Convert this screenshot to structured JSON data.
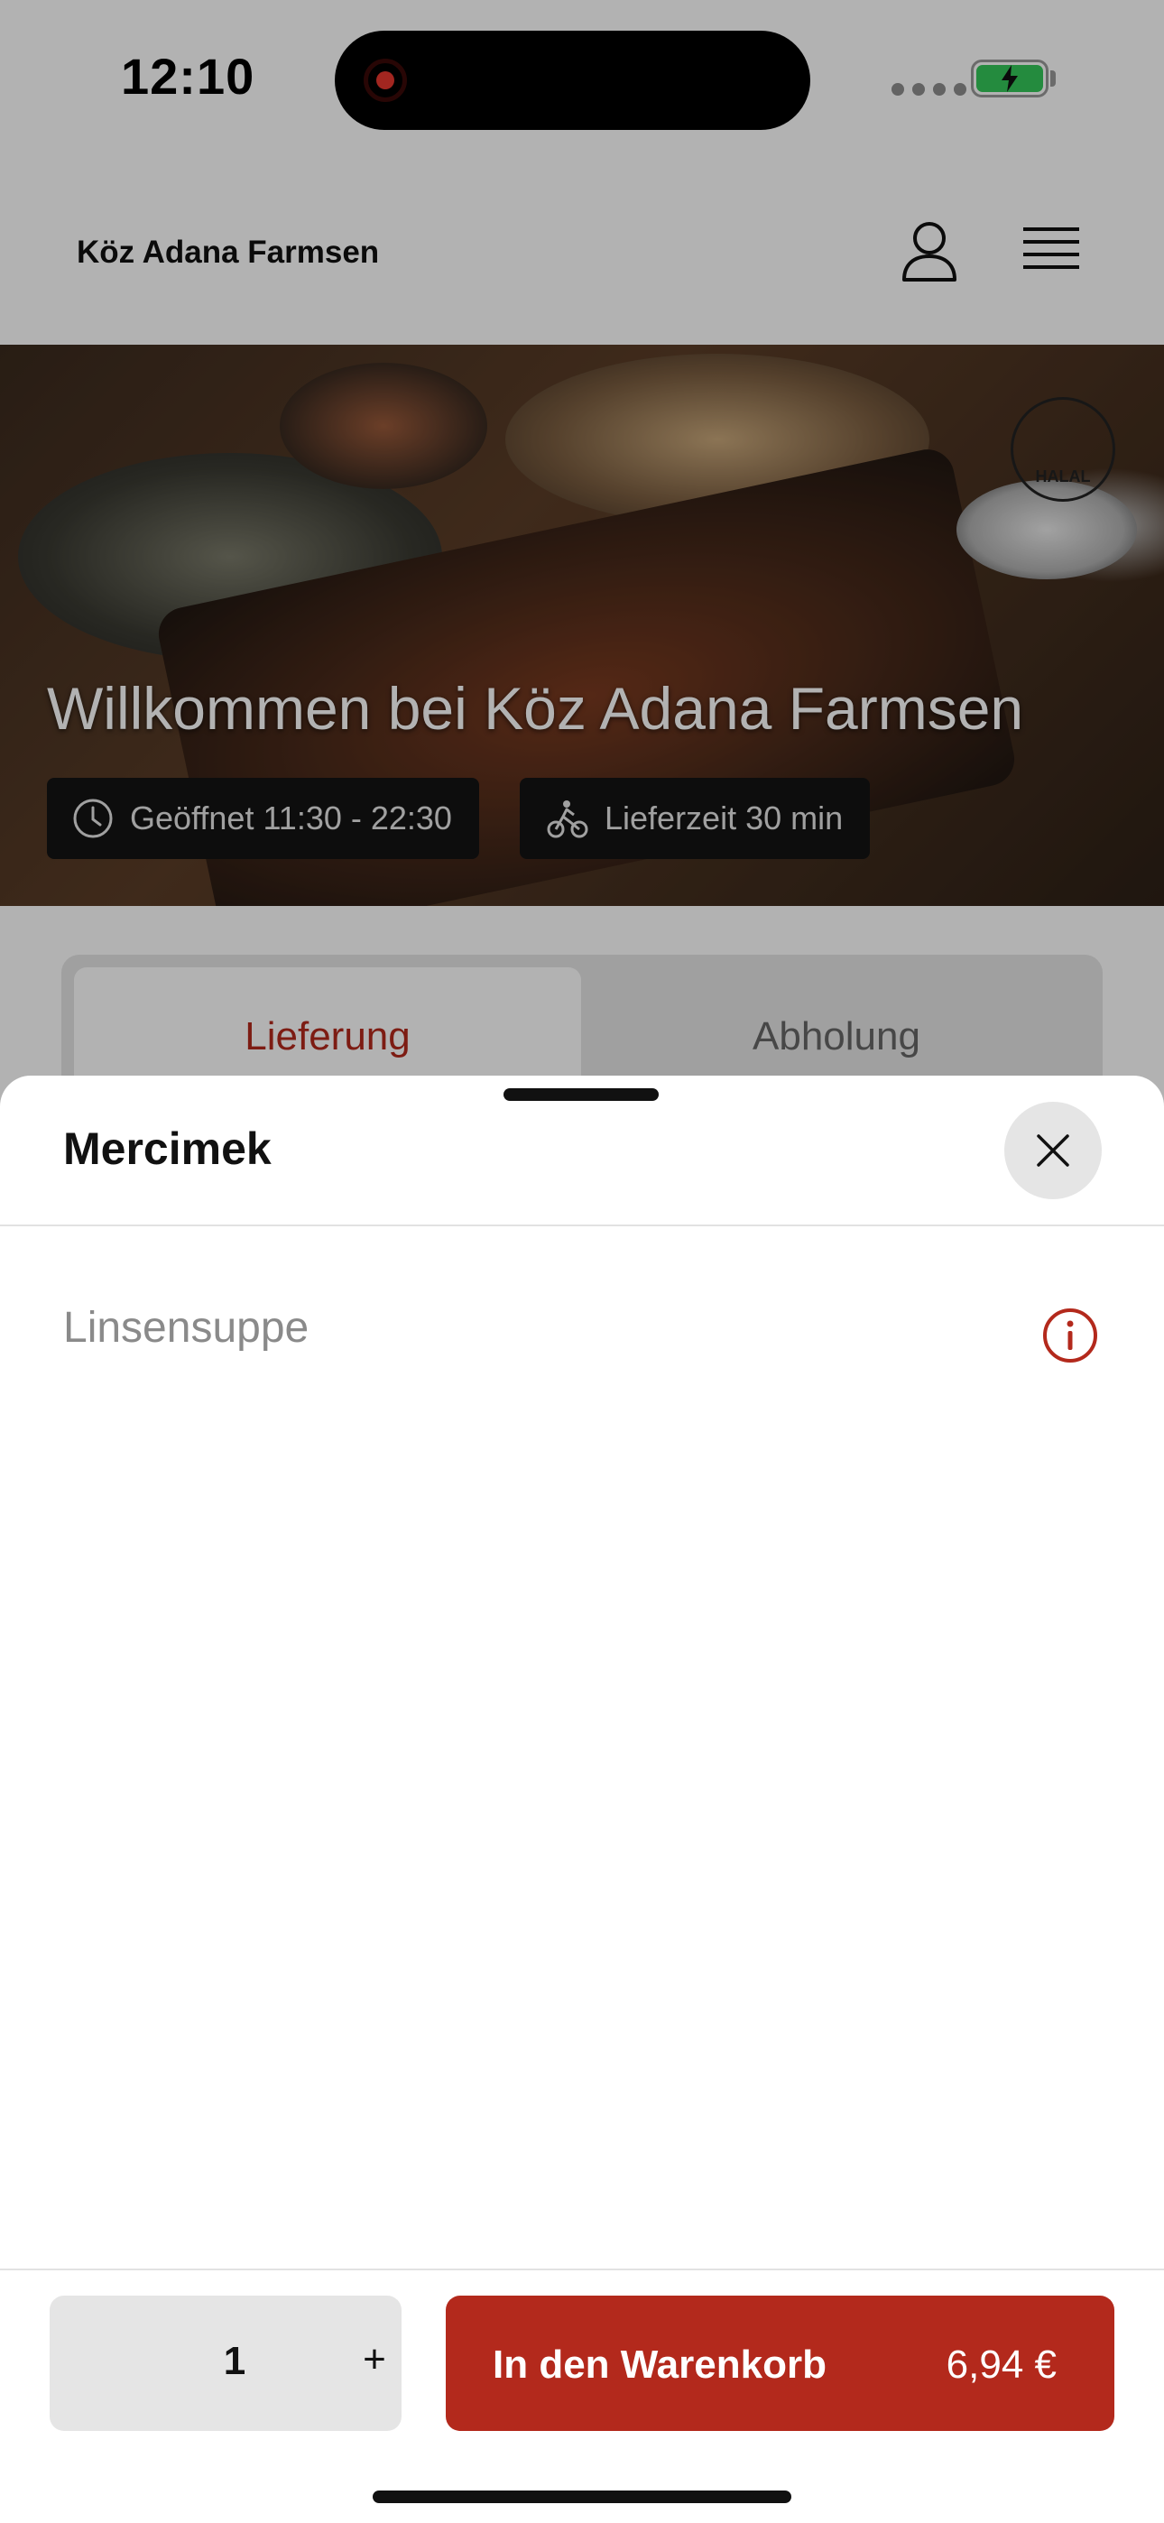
{
  "status_bar": {
    "time": "12:10"
  },
  "header": {
    "brand": "Köz Adana Farmsen"
  },
  "hero": {
    "title": "Willkommen bei Köz Adana Farmsen",
    "opening_hours": "Geöffnet 11:30 - 22:30",
    "delivery_time": "Lieferzeit 30 min",
    "badge": "HALAL"
  },
  "order_mode": {
    "tabs": [
      {
        "label": "Lieferung",
        "active": true
      },
      {
        "label": "Abholung",
        "active": false
      }
    ]
  },
  "sheet": {
    "title": "Mercimek",
    "description": "Linsensuppe",
    "quantity": "1",
    "plus_label": "+",
    "cart_button_label": "In den Warenkorb",
    "price": "6,94 €"
  },
  "colors": {
    "accent": "#b3291c",
    "toggle_bg": "#e5e5e5",
    "battery": "#34c759"
  }
}
